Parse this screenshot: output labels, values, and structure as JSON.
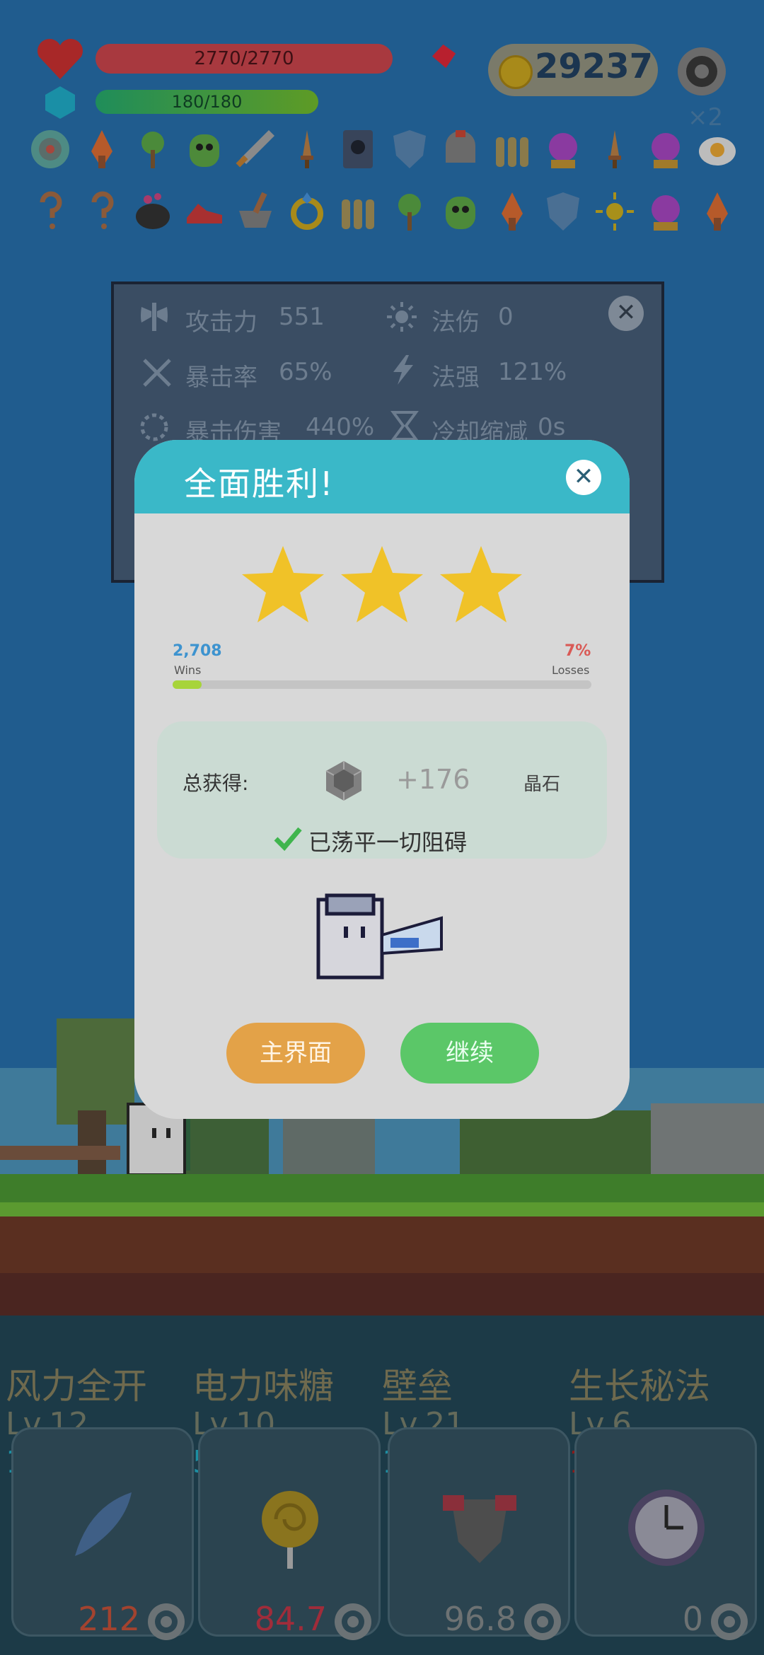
{
  "hud": {
    "hp_text": "2770/2770",
    "mp_text": "180/180",
    "coins": "29237"
  },
  "inventory": {
    "multiplier": "×2",
    "row1_icons": [
      "target-icon",
      "flame-torch-icon",
      "sapling-icon",
      "green-monster-icon",
      "sword-icon",
      "dagger-icon",
      "skull-book-icon",
      "shield-icon",
      "helmet-icon",
      "bullets-icon",
      "crystal-ball-icon",
      "dagger-icon",
      "crystal-ball-icon",
      "fried-egg-icon"
    ],
    "row2_icons": [
      "question-icon",
      "question-icon",
      "cauldron-icon",
      "sneaker-icon",
      "mortar-icon",
      "gold-ring-icon",
      "bullets-icon",
      "sapling-icon",
      "green-monster-icon",
      "flame-torch-icon",
      "shield-icon",
      "sun-gem-icon",
      "crystal-ball-icon",
      "flame-torch-icon"
    ]
  },
  "stats": {
    "attack_label": "攻击力",
    "attack_value": "551",
    "magic_dmg_label": "法伤",
    "magic_dmg_value": "0",
    "crit_rate_label": "暴击率",
    "crit_rate_value": "65%",
    "spell_power_label": "法强",
    "spell_power_value": "121%",
    "crit_dmg_label": "暴击伤害",
    "crit_dmg_value": "440%",
    "cooldown_label": "冷却缩减",
    "cooldown_value": "0s"
  },
  "dialog": {
    "title": "全面胜利!",
    "stars": 3,
    "wins_value": "2,708",
    "wins_label": "Wins",
    "losses_value": "7%",
    "losses_label": "Losses",
    "progress_fraction": 0.07,
    "reward_label": "总获得:",
    "reward_amount": "+176",
    "reward_unit": "晶石",
    "clear_text": "已荡平一切阻碍",
    "btn_main": "主界面",
    "btn_continue": "继续"
  },
  "skills": [
    {
      "name": "风力全开",
      "level": "Lv.12",
      "cost": "15",
      "cost_color": "#1c8fa3",
      "value": "212",
      "value_color": "#a3432f",
      "icon": "feather-icon"
    },
    {
      "name": "电力味糖",
      "level": "Lv.10",
      "cost": "5",
      "cost_color": "#1c8fa3",
      "value": "84.7",
      "value_color": "#a02c3a",
      "icon": "lollipop-icon"
    },
    {
      "name": "壁垒",
      "level": "Lv.21",
      "cost": "10",
      "cost_color": "#1c8fa3",
      "value": "96.8",
      "value_color": "#6d7273",
      "icon": "armor-icon"
    },
    {
      "name": "生长秘法",
      "level": "Lv.6",
      "cost": "100",
      "cost_color": "#8c1a1a",
      "value": "0",
      "value_color": "#6d7273",
      "icon": "clock-icon"
    }
  ]
}
